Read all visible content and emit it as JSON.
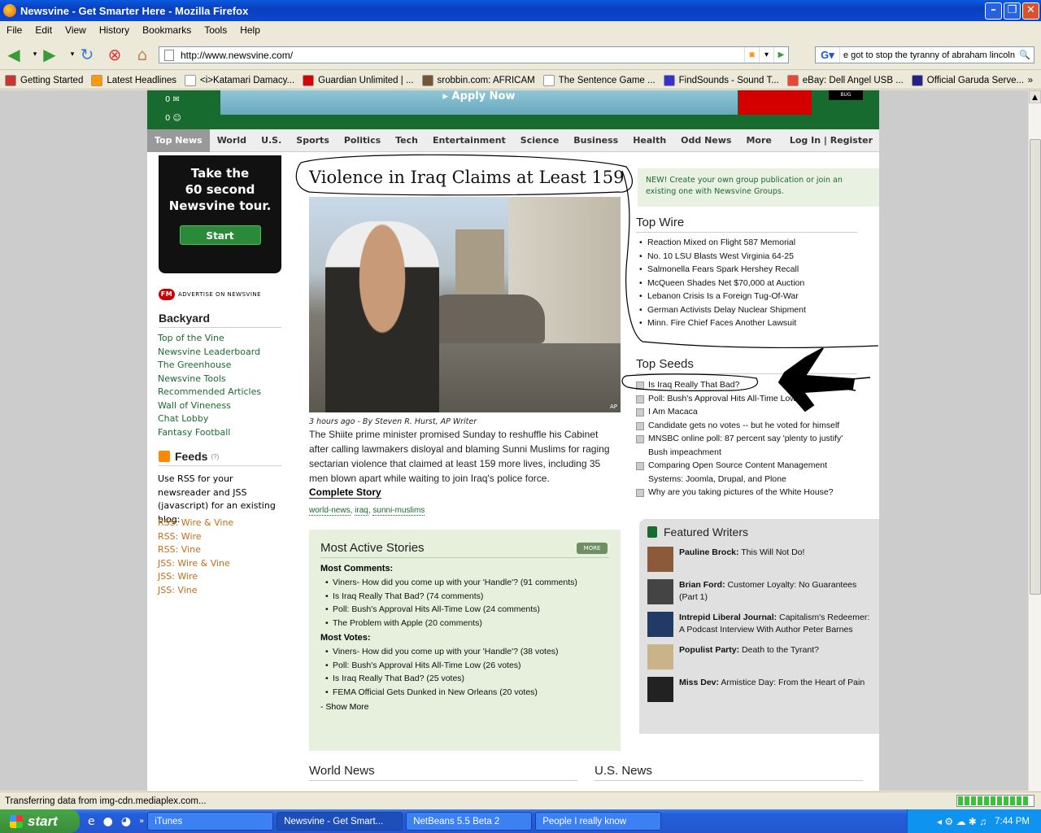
{
  "window": {
    "title": "Newsvine - Get Smarter Here - Mozilla Firefox"
  },
  "menu": [
    "File",
    "Edit",
    "View",
    "History",
    "Bookmarks",
    "Tools",
    "Help"
  ],
  "nav": {
    "url": "http://www.newsvine.com/",
    "search_query": "e got to stop the tyranny of abraham lincoln"
  },
  "bookmarks": [
    {
      "label": "Getting Started",
      "color": "#c33"
    },
    {
      "label": "Latest Headlines",
      "color": "#f90"
    },
    {
      "label": "<i>Katamari Damacy...",
      "color": "#fff"
    },
    {
      "label": "Guardian Unlimited | ...",
      "color": "#d00"
    },
    {
      "label": "srobbin.com: AFRICAM",
      "color": "#753"
    },
    {
      "label": "The Sentence Game ...",
      "color": "#fff"
    },
    {
      "label": "FindSounds - Sound T...",
      "color": "#33c"
    },
    {
      "label": "eBay: Dell Angel USB ...",
      "color": "#e43"
    },
    {
      "label": "Official Garuda Serve...",
      "color": "#228"
    }
  ],
  "site": {
    "counts": [
      "0",
      "0"
    ],
    "apply_now": "▸ Apply Now",
    "bug_label": "BUG",
    "tabs": [
      "Top News",
      "World",
      "U.S.",
      "Sports",
      "Politics",
      "Tech",
      "Entertainment",
      "Science",
      "Business",
      "Health",
      "Odd News",
      "More"
    ],
    "login": "Log In | Register",
    "tour": {
      "line1": "Take the",
      "line2": "60 second",
      "line3": "Newsvine tour.",
      "start": "Start"
    },
    "advertise": "ADVERTISE ON NEWSVINE",
    "backyard": {
      "title": "Backyard",
      "links": [
        "Top of the Vine",
        "Newsvine Leaderboard",
        "The Greenhouse",
        "Newsvine Tools",
        "Recommended Articles",
        "Wall of Vineness",
        "Chat Lobby",
        "Fantasy Football"
      ]
    },
    "feeds": {
      "title": "Feeds",
      "help": "(?)",
      "text": "Use RSS for your newsreader and JSS (javascript) for an existing blog:",
      "links": [
        "RSS: Wire & Vine",
        "RSS: Wire",
        "RSS: Vine",
        "JSS: Wire & Vine",
        "JSS: Wire",
        "JSS: Vine"
      ]
    },
    "story": {
      "headline": "Violence in Iraq Claims at Least 159",
      "photo_credit": "AP",
      "byline": "3 hours ago - By Steven R. Hurst, AP Writer",
      "summary": "The Shiite prime minister promised Sunday to reshuffle his Cabinet after calling lawmakers disloyal and blaming Sunni Muslims for raging sectarian violence that claimed at least 159 more lives, including 35 men blown apart while waiting to join Iraq's police force.",
      "complete": "Complete Story",
      "tags": [
        "world-news",
        "iraq",
        "sunni-muslims"
      ]
    },
    "most_active": {
      "title": "Most Active Stories",
      "more": "MORE",
      "comments_label": "Most Comments:",
      "comments": [
        "Viners- How did you come up with your 'Handle'? (91 comments)",
        "Is Iraq Really That Bad? (74 comments)",
        "Poll: Bush's Approval Hits All-Time Low (24 comments)",
        "The Problem with Apple (20 comments)"
      ],
      "votes_label": "Most Votes:",
      "votes": [
        "Viners- How did you come up with your 'Handle'? (38 votes)",
        "Poll: Bush's Approval Hits All-Time Low (26 votes)",
        "Is Iraq Really That Bad? (25 votes)",
        "FEMA Official Gets Dunked in New Orleans (20 votes)"
      ],
      "show_more": "- Show More"
    },
    "world_news": "World News",
    "us_news": "U.S. News",
    "new_box": "NEW! Create your own group publication or join an existing one with Newsvine Groups.",
    "top_wire": {
      "title": "Top Wire",
      "items": [
        "Reaction Mixed on Flight 587 Memorial",
        "No. 10 LSU Blasts West Virginia 64-25",
        "Salmonella Fears Spark Hershey Recall",
        "McQueen Shades Net $70,000 at Auction",
        "Lebanon Crisis Is a Foreign Tug-Of-War",
        "German Activists Delay Nuclear Shipment",
        "Minn. Fire Chief Faces Another Lawsuit"
      ]
    },
    "top_seeds": {
      "title": "Top Seeds",
      "items": [
        "Is Iraq Really That Bad?",
        "Poll: Bush's Approval Hits All-Time Low",
        "I Am Macaca",
        "Candidate gets no votes -- but he voted for himself",
        "MNSBC online poll: 87 percent say 'plenty to justify' Bush impeachment",
        "Comparing Open Source Content Management Systems: Joomla, Drupal, and Plone",
        "Why are you taking pictures of the White House?"
      ]
    },
    "featured": {
      "title": "Featured Writers",
      "writers": [
        {
          "name": "Pauline Brock:",
          "text": "This Will Not Do!"
        },
        {
          "name": "Brian Ford:",
          "text": "Customer Loyalty: No Guarantees (Part 1)"
        },
        {
          "name": "Intrepid Liberal Journal:",
          "text": "Capitalism's Redeemer: A Podcast Interview With Author Peter Barnes"
        },
        {
          "name": "Populist Party:",
          "text": "Death to the Tyrant?"
        },
        {
          "name": "Miss Dev:",
          "text": "Armistice Day: From the Heart of Pain"
        }
      ]
    }
  },
  "status": {
    "text": "Transferring data from img-cdn.mediaplex.com...",
    "progress": 0.95
  },
  "taskbar": {
    "start": "start",
    "tasks": [
      "iTunes",
      "Newsvine - Get Smart...",
      "NetBeans 5.5 Beta 2",
      "People I really know"
    ],
    "clock": "7:44 PM"
  }
}
